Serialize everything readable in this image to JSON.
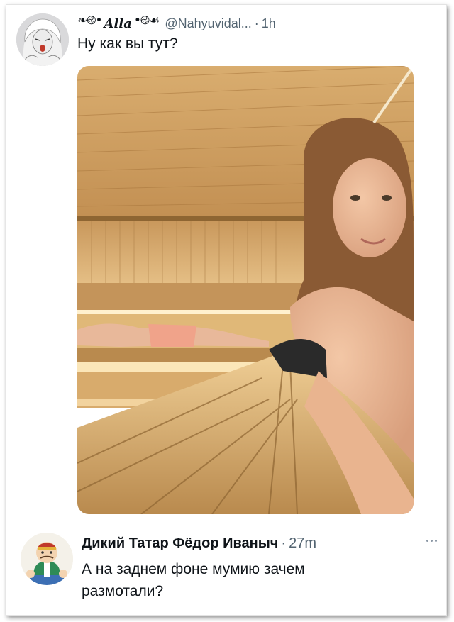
{
  "tweet1": {
    "display_name": "Alla",
    "name_ornament_left": "❧࿋•",
    "name_ornament_right": "•࿋☙",
    "handle": "@Nahyuvidal...",
    "separator": "·",
    "time": "1h",
    "text": "Ну как вы тут?",
    "avatar_icon": "woman-avatar"
  },
  "tweet2": {
    "display_name": "Дикий Татар Фёдор Иваныч",
    "separator": "·",
    "time": "27m",
    "text": "А на заднем фоне мумию зачем размотали?",
    "avatar_icon": "cartoon-tatar-avatar",
    "more_icon": "more-dots-icon"
  },
  "colors": {
    "text_primary": "#0f1419",
    "text_secondary": "#536471",
    "wood_light": "#e9c58b",
    "wood_dark": "#b98a4e"
  }
}
